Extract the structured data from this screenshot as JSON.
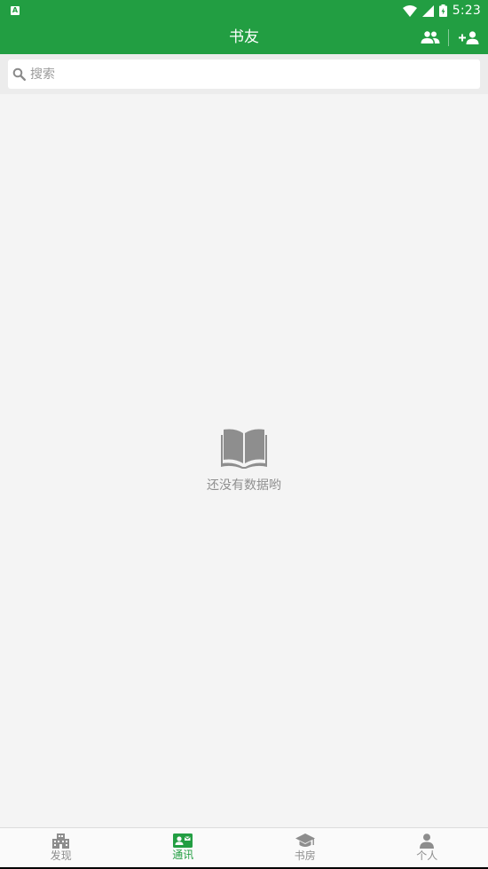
{
  "status_bar": {
    "badge": "A",
    "time": "5:23"
  },
  "app_bar": {
    "title": "书友"
  },
  "search": {
    "placeholder": "搜索",
    "value": ""
  },
  "empty_state": {
    "message": "还没有数据哟"
  },
  "bottom_nav": {
    "items": [
      {
        "label": "发现",
        "icon": "buildings-icon",
        "active": false
      },
      {
        "label": "通讯",
        "icon": "contact-card-icon",
        "active": true
      },
      {
        "label": "书房",
        "icon": "graduation-cap-icon",
        "active": false
      },
      {
        "label": "个人",
        "icon": "person-icon",
        "active": false
      }
    ]
  },
  "colors": {
    "brand": "#229e42",
    "background": "#f4f4f4",
    "inactive": "#8d8d8d"
  }
}
